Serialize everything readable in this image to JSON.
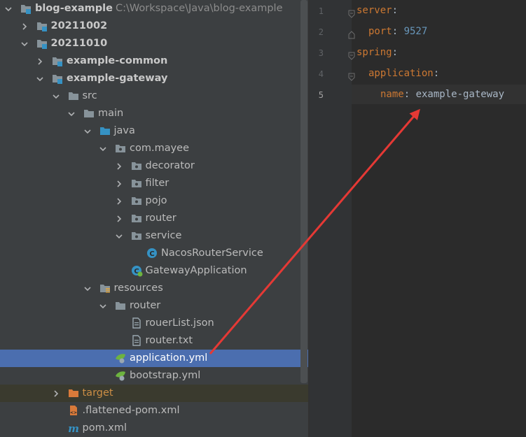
{
  "project": {
    "name": "blog-example",
    "path": "C:\\Workspace\\Java\\blog-example"
  },
  "tree": [
    {
      "label": "20211002",
      "kind": "module",
      "bold": true,
      "state": "collapsed"
    },
    {
      "label": "20211010",
      "kind": "module",
      "bold": true,
      "state": "expanded"
    },
    {
      "label": "example-common",
      "kind": "module",
      "bold": true,
      "state": "collapsed"
    },
    {
      "label": "example-gateway",
      "kind": "module",
      "bold": true,
      "state": "expanded"
    },
    {
      "label": "src",
      "kind": "folder",
      "state": "expanded"
    },
    {
      "label": "main",
      "kind": "folder",
      "state": "expanded"
    },
    {
      "label": "java",
      "kind": "source-folder",
      "state": "expanded"
    },
    {
      "label": "com.mayee",
      "kind": "package",
      "state": "expanded"
    },
    {
      "label": "decorator",
      "kind": "package",
      "state": "collapsed"
    },
    {
      "label": "filter",
      "kind": "package",
      "state": "collapsed"
    },
    {
      "label": "pojo",
      "kind": "package",
      "state": "collapsed"
    },
    {
      "label": "router",
      "kind": "package",
      "state": "collapsed"
    },
    {
      "label": "service",
      "kind": "package",
      "state": "expanded"
    },
    {
      "label": "NacosRouterService",
      "kind": "class"
    },
    {
      "label": "GatewayApplication",
      "kind": "spring-class"
    },
    {
      "label": "resources",
      "kind": "resources-folder",
      "state": "expanded"
    },
    {
      "label": "router",
      "kind": "folder",
      "state": "expanded"
    },
    {
      "label": "rouerList.json",
      "kind": "file"
    },
    {
      "label": "router.txt",
      "kind": "file"
    },
    {
      "label": "application.yml",
      "kind": "yaml",
      "selected": true
    },
    {
      "label": "bootstrap.yml",
      "kind": "yaml"
    },
    {
      "label": "target",
      "kind": "excluded-folder",
      "state": "collapsed",
      "excluded": true
    },
    {
      "label": ".flattened-pom.xml",
      "kind": "xml"
    },
    {
      "label": "pom.xml",
      "kind": "maven"
    }
  ],
  "editor": {
    "lines": [
      {
        "num": "1",
        "key": "server",
        "colon": ":",
        "value": ""
      },
      {
        "num": "2",
        "key": "port",
        "colon": ": ",
        "value": "9527",
        "value_type": "number"
      },
      {
        "num": "3",
        "key": "spring",
        "colon": ":",
        "value": ""
      },
      {
        "num": "4",
        "key": "application",
        "colon": ":",
        "value": ""
      },
      {
        "num": "5",
        "key": "name",
        "colon": ": ",
        "value": "example-gateway",
        "value_type": "string",
        "current": true
      }
    ]
  },
  "annotation": {
    "color": "#e53935"
  }
}
